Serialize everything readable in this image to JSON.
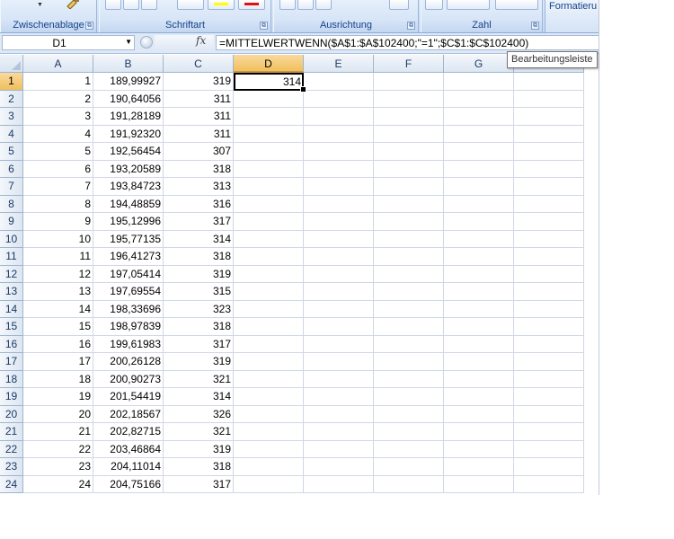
{
  "ribbon": {
    "groups": [
      {
        "label": "Zwischenablage"
      },
      {
        "label": "Schriftart"
      },
      {
        "label": "Ausrichtung"
      },
      {
        "label": "Zahl"
      }
    ],
    "styles_label": "Formatieru",
    "colors": {
      "highlight": "#ffff00",
      "font_color": "#e01010"
    },
    "launcher_glyph": "⧉"
  },
  "formula_bar": {
    "name_box": "D1",
    "fx_label": "fx",
    "formula": "=MITTELWERTWENN($A$1:$A$102400;\"=1\";$C$1:$C$102400)",
    "tooltip": "Bearbeitungsleiste"
  },
  "sheet": {
    "columns": [
      "A",
      "B",
      "C",
      "D",
      "E",
      "F",
      "G"
    ],
    "selected_column": "D",
    "selected_row": 1,
    "active_cell_value": "314",
    "rows": [
      {
        "n": "1",
        "a": "1",
        "b": "189,99927",
        "c": "319",
        "d": "314"
      },
      {
        "n": "2",
        "a": "2",
        "b": "190,64056",
        "c": "311",
        "d": ""
      },
      {
        "n": "3",
        "a": "3",
        "b": "191,28189",
        "c": "311",
        "d": ""
      },
      {
        "n": "4",
        "a": "4",
        "b": "191,92320",
        "c": "311",
        "d": ""
      },
      {
        "n": "5",
        "a": "5",
        "b": "192,56454",
        "c": "307",
        "d": ""
      },
      {
        "n": "6",
        "a": "6",
        "b": "193,20589",
        "c": "318",
        "d": ""
      },
      {
        "n": "7",
        "a": "7",
        "b": "193,84723",
        "c": "313",
        "d": ""
      },
      {
        "n": "8",
        "a": "8",
        "b": "194,48859",
        "c": "316",
        "d": ""
      },
      {
        "n": "9",
        "a": "9",
        "b": "195,12996",
        "c": "317",
        "d": ""
      },
      {
        "n": "10",
        "a": "10",
        "b": "195,77135",
        "c": "314",
        "d": ""
      },
      {
        "n": "11",
        "a": "11",
        "b": "196,41273",
        "c": "318",
        "d": ""
      },
      {
        "n": "12",
        "a": "12",
        "b": "197,05414",
        "c": "319",
        "d": ""
      },
      {
        "n": "13",
        "a": "13",
        "b": "197,69554",
        "c": "315",
        "d": ""
      },
      {
        "n": "14",
        "a": "14",
        "b": "198,33696",
        "c": "323",
        "d": ""
      },
      {
        "n": "15",
        "a": "15",
        "b": "198,97839",
        "c": "318",
        "d": ""
      },
      {
        "n": "16",
        "a": "16",
        "b": "199,61983",
        "c": "317",
        "d": ""
      },
      {
        "n": "17",
        "a": "17",
        "b": "200,26128",
        "c": "319",
        "d": ""
      },
      {
        "n": "18",
        "a": "18",
        "b": "200,90273",
        "c": "321",
        "d": ""
      },
      {
        "n": "19",
        "a": "19",
        "b": "201,54419",
        "c": "314",
        "d": ""
      },
      {
        "n": "20",
        "a": "20",
        "b": "202,18567",
        "c": "326",
        "d": ""
      },
      {
        "n": "21",
        "a": "21",
        "b": "202,82715",
        "c": "321",
        "d": ""
      },
      {
        "n": "22",
        "a": "22",
        "b": "203,46864",
        "c": "319",
        "d": ""
      },
      {
        "n": "23",
        "a": "23",
        "b": "204,11014",
        "c": "318",
        "d": ""
      },
      {
        "n": "24",
        "a": "24",
        "b": "204,75166",
        "c": "317",
        "d": ""
      }
    ]
  }
}
